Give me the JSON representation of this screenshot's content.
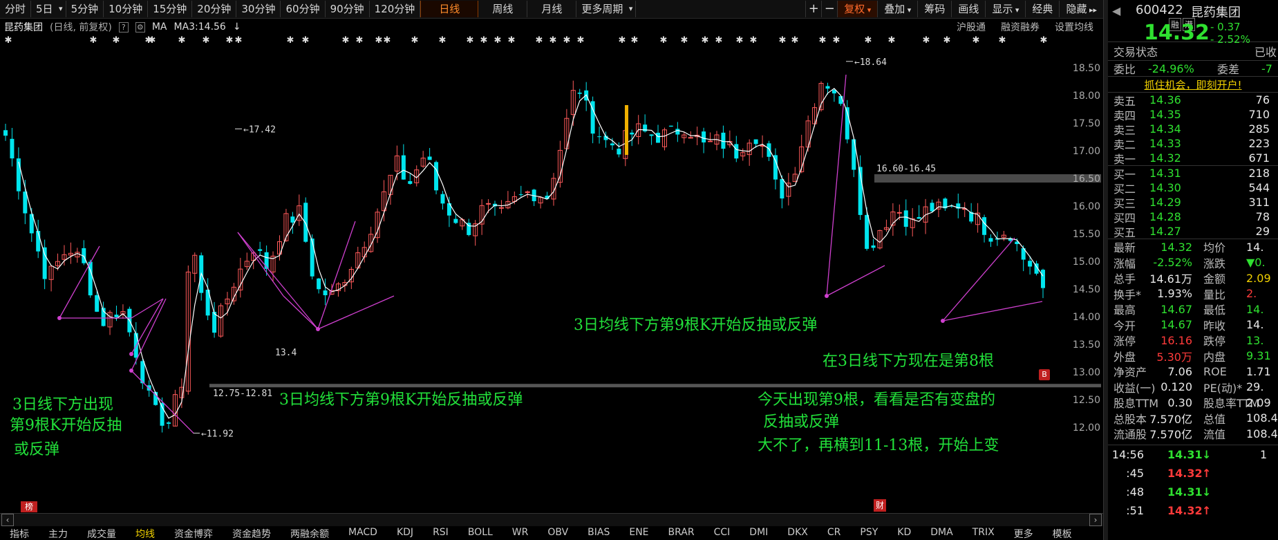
{
  "toolbar": {
    "periods": [
      "分时",
      "5日",
      "5分钟",
      "10分钟",
      "15分钟",
      "20分钟",
      "30分钟",
      "60分钟",
      "90分钟",
      "120分钟",
      "日线",
      "周线",
      "月线",
      "更多周期"
    ],
    "active_period": "日线",
    "right_buttons": [
      "+",
      "−",
      "复权",
      "叠加",
      "筹码",
      "画线",
      "显示",
      "经典",
      "隐藏"
    ]
  },
  "info": {
    "name": "昆药集团",
    "mode": "(日线, 前复权)",
    "help": "?",
    "ma": "MA",
    "ma3": "MA3:14.56",
    "right": [
      "沪股通",
      "融资融券",
      "设置均线"
    ]
  },
  "y_ticks": [
    "18.50",
    "18.00",
    "17.50",
    "17.00",
    "16.50",
    "16.00",
    "15.50",
    "15.00",
    "14.50",
    "14.00",
    "13.50",
    "13.00",
    "12.50",
    "12.00"
  ],
  "price_marks": {
    "high1": "17.42",
    "high2": "18.64",
    "low1": "11.92",
    "low_partial": "13.4",
    "range1": "12.75-12.81",
    "range2": "16.60-16.45"
  },
  "annotations": {
    "a1_l1": "3日线下方出现",
    "a1_l2": "第9根K开始反抽",
    "a1_l3": "或反弹",
    "a2": "3日均线下方第9根K开始反抽或反弹",
    "a3": "3日均线下方第9根K开始反抽或反弹",
    "a4": "在3日线下方现在是第8根",
    "a5": "今天出现第9根，看看是否有变盘的",
    "a6": "反抽或反弹",
    "a7": "大不了，再横到11-13根，开始上变"
  },
  "badges": {
    "bang": "榜",
    "cai": "财",
    "b": "B"
  },
  "bottom_tabs": [
    "指标",
    "主力",
    "成交量",
    "均线",
    "资金博弈",
    "资金趋势",
    "两融余额",
    "MACD",
    "KDJ",
    "RSI",
    "BOLL",
    "WR",
    "OBV",
    "BIAS",
    "ENE",
    "BRAR",
    "CCI",
    "DMI",
    "DKX",
    "CR",
    "PSY",
    "KD",
    "DMA",
    "TRIX",
    "更多",
    "模板"
  ],
  "bottom_tabs_highlight": "均线",
  "quote": {
    "code": "600422",
    "name": "昆药集团",
    "tags": [
      "融",
      "港"
    ],
    "price": "14.32",
    "change": "- 0.37",
    "change_pct": "- 2.52%",
    "status_label": "交易状态",
    "status_value": "已收",
    "weibi_label": "委比",
    "weibi_value": "-24.96%",
    "weicha_label": "委差",
    "weicha_value": "-7",
    "promo": "抓住机会，即刻开户!",
    "asks": [
      {
        "label": "卖五",
        "price": "14.36",
        "vol": "76"
      },
      {
        "label": "卖四",
        "price": "14.35",
        "vol": "710"
      },
      {
        "label": "卖三",
        "price": "14.34",
        "vol": "285"
      },
      {
        "label": "卖二",
        "price": "14.33",
        "vol": "223"
      },
      {
        "label": "卖一",
        "price": "14.32",
        "vol": "671"
      }
    ],
    "bids": [
      {
        "label": "买一",
        "price": "14.31",
        "vol": "218"
      },
      {
        "label": "买二",
        "price": "14.30",
        "vol": "544"
      },
      {
        "label": "买三",
        "price": "14.29",
        "vol": "311"
      },
      {
        "label": "买四",
        "price": "14.28",
        "vol": "78"
      },
      {
        "label": "买五",
        "price": "14.27",
        "vol": "29"
      }
    ],
    "stats": [
      {
        "l1": "最新",
        "v1": "14.32",
        "c1": "g",
        "l2": "均价",
        "v2": "14.",
        "c2": "w"
      },
      {
        "l1": "涨幅",
        "v1": "-2.52%",
        "c1": "g",
        "l2": "涨跌",
        "v2": "▼0.",
        "c2": "g"
      },
      {
        "l1": "总手",
        "v1": "14.61万",
        "c1": "w",
        "l2": "金额",
        "v2": "2.09",
        "c2": "y"
      },
      {
        "l1": "换手*",
        "v1": "1.93%",
        "c1": "w",
        "l2": "量比",
        "v2": "2.",
        "c2": "r"
      },
      {
        "l1": "最高",
        "v1": "14.67",
        "c1": "g",
        "l2": "最低",
        "v2": "14.",
        "c2": "g"
      },
      {
        "l1": "今开",
        "v1": "14.67",
        "c1": "g",
        "l2": "昨收",
        "v2": "14.",
        "c2": "w"
      },
      {
        "l1": "涨停",
        "v1": "16.16",
        "c1": "r",
        "l2": "跌停",
        "v2": "13.",
        "c2": "g"
      },
      {
        "l1": "外盘",
        "v1": "5.30万",
        "c1": "r",
        "l2": "内盘",
        "v2": "9.31",
        "c2": "g"
      },
      {
        "l1": "净资产",
        "v1": "7.06",
        "c1": "w",
        "l2": "ROE",
        "v2": "1.71",
        "c2": "w"
      },
      {
        "l1": "收益(一)",
        "v1": "0.120",
        "c1": "w",
        "l2": "PE(动)*",
        "v2": "29.",
        "c2": "w"
      },
      {
        "l1": "股息TTM",
        "v1": "0.30",
        "c1": "w",
        "l2": "股息率TTM",
        "v2": "2.09",
        "c2": "w"
      },
      {
        "l1": "总股本",
        "v1": "7.570亿",
        "c1": "w",
        "l2": "总值",
        "v2": "108.4",
        "c2": "w"
      },
      {
        "l1": "流通股",
        "v1": "7.570亿",
        "c1": "w",
        "l2": "流值",
        "v2": "108.4",
        "c2": "w"
      }
    ],
    "ticks": [
      {
        "time": "14:56",
        "price": "14.31",
        "dir": "↓",
        "vol": "1",
        "color": "g"
      },
      {
        "time": ":45",
        "price": "14.32",
        "dir": "↑",
        "vol": "",
        "color": "r"
      },
      {
        "time": ":48",
        "price": "14.31",
        "dir": "↓",
        "vol": "",
        "color": "g"
      },
      {
        "time": ":51",
        "price": "14.32",
        "dir": "↑",
        "vol": "",
        "color": "r"
      }
    ]
  },
  "colors": {
    "up": "#ff5a5a",
    "down": "#00e5ee",
    "ma": "#ffffff",
    "purple": "#d040d0",
    "green_text": "#22e03a"
  }
}
